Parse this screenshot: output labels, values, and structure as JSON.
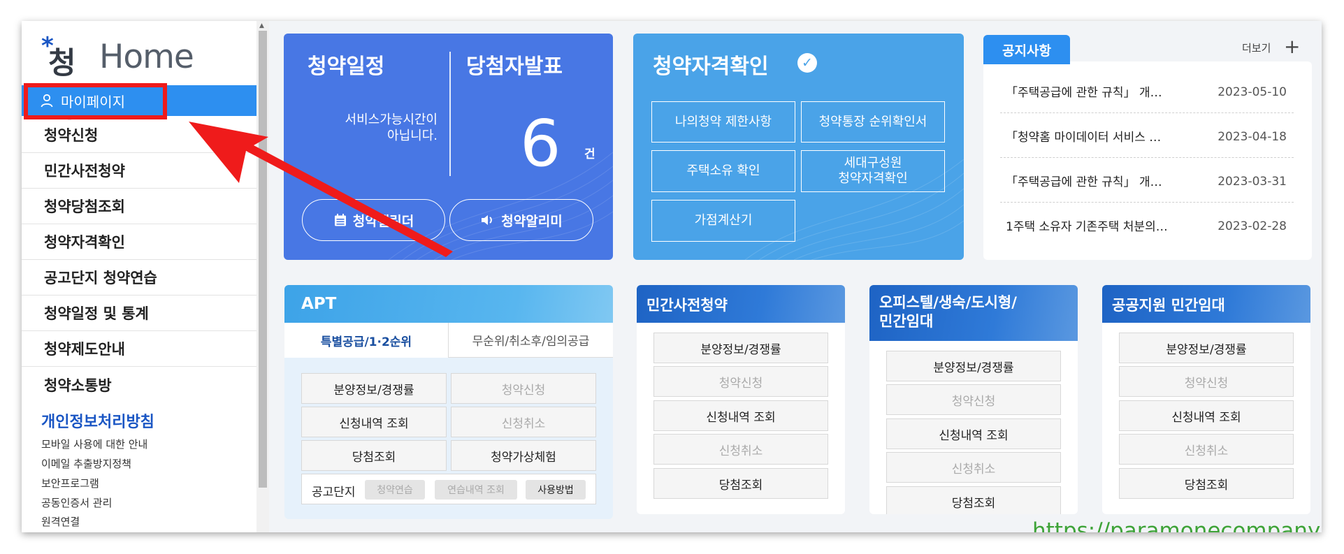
{
  "sidebar": {
    "logo": {
      "mark": "*",
      "korean": "청약",
      "home": "Home"
    },
    "mypage_label": "마이페이지",
    "nav": [
      "청약신청",
      "민간사전청약",
      "청약당첨조회",
      "청약자격확인",
      "공고단지 청약연습",
      "청약일정 및 통계",
      "청약제도안내",
      "청약소통방"
    ],
    "privacy_title": "개인정보처리방침",
    "links": [
      "모바일 사용에 대한 안내",
      "이메일 추출방지정책",
      "보안프로그램",
      "공동인증서 관리",
      "원격연결"
    ]
  },
  "schedule_card": {
    "title_left": "청약일정",
    "title_right": "당첨자발표",
    "service_msg_line1": "서비스가능시간이",
    "service_msg_line2": "아닙니다.",
    "count": "6",
    "count_unit": "건",
    "btn_calendar": "청약캘린더",
    "btn_alarm": "청약알리미"
  },
  "qual_card": {
    "title": "청약자격확인",
    "buttons": [
      "나의청약 제한사항",
      "청약통장 순위확인서",
      "주택소유 확인"
    ],
    "household_line1": "세대구성원",
    "household_line2": "청약자격확인",
    "calc": "가점계산기"
  },
  "notice": {
    "tab": "공지사항",
    "more": "더보기",
    "items": [
      {
        "title": "「주택공급에 관한 규칙」 개…",
        "date": "2023-05-10"
      },
      {
        "title": "「청약홈 마이데이터 서비스 …",
        "date": "2023-04-18"
      },
      {
        "title": "「주택공급에 관한 규칙」 개…",
        "date": "2023-03-31"
      },
      {
        "title": "1주택 소유자 기존주택 처분의…",
        "date": "2023-02-28"
      }
    ]
  },
  "apt": {
    "title": "APT",
    "tab_active": "특별공급/1·2순위",
    "tab_inactive": "무순위/취소후/임의공급",
    "buttons": [
      {
        "label": "분양정보/경쟁률",
        "disabled": false
      },
      {
        "label": "청약신청",
        "disabled": true
      },
      {
        "label": "신청내역 조회",
        "disabled": false
      },
      {
        "label": "신청취소",
        "disabled": true
      },
      {
        "label": "당첨조회",
        "disabled": false
      },
      {
        "label": "청약가상체험",
        "disabled": false
      }
    ],
    "practice_label": "공고단지",
    "chips": [
      "청약연습",
      "연습내역 조회",
      "사용방법"
    ]
  },
  "private_pre": {
    "title": "민간사전청약",
    "buttons": [
      "분양정보/경쟁률",
      "청약신청",
      "신청내역 조회",
      "신청취소",
      "당첨조회"
    ]
  },
  "officetel": {
    "title_line1": "오피스텔/생숙/도시형/",
    "title_line2": "민간임대",
    "buttons": [
      "분양정보/경쟁률",
      "청약신청",
      "신청내역 조회",
      "신청취소",
      "당첨조회"
    ]
  },
  "public_rental": {
    "title": "공공지원 민간임대",
    "buttons": [
      "분양정보/경쟁률",
      "청약신청",
      "신청내역 조회",
      "신청취소",
      "당첨조회"
    ]
  },
  "watermark": "https://paramonecompany.com/",
  "colors": {
    "accent_blue": "#2d8ff0",
    "schedule_card": "#4877e4",
    "qual_card": "#4aa3e8",
    "highlight_red": "#ef1b1b",
    "watermark_green": "#3ea338"
  }
}
